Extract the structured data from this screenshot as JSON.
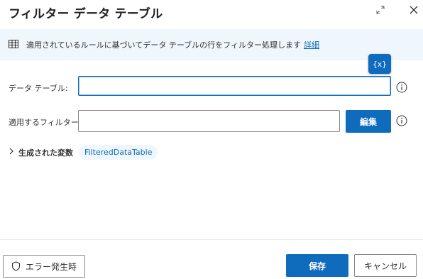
{
  "dialog": {
    "title": "フィルター データ テーブル"
  },
  "info": {
    "text": "適用されているルールに基づいてデータ テーブルの行をフィルター処理します",
    "link": "詳細"
  },
  "variable_button": {
    "label": "{x}"
  },
  "fields": {
    "data_table": {
      "label": "データ テーブル:",
      "value": ""
    },
    "filter": {
      "label": "適用するフィルター :",
      "value": "",
      "edit_label": "編集"
    }
  },
  "produced_variables": {
    "label": "生成された変数",
    "variable": "FilteredDataTable"
  },
  "footer": {
    "on_error_label": "エラー発生時",
    "save_label": "保存",
    "cancel_label": "キャンセル"
  },
  "colors": {
    "accent": "#0f6cbd",
    "banner": "#eff6fc"
  }
}
